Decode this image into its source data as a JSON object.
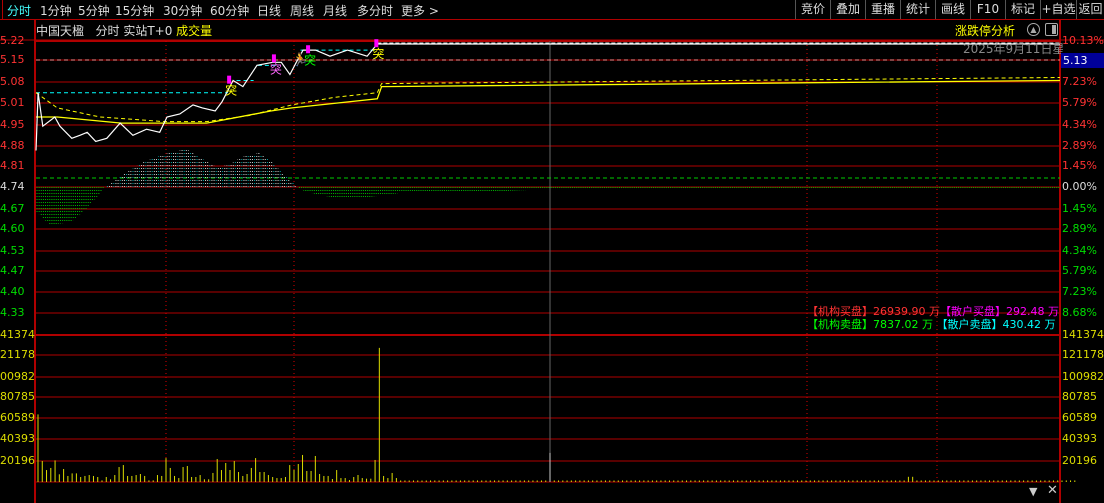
{
  "toolbar": {
    "periods": [
      "分时",
      "1分钟",
      "5分钟",
      "15分钟",
      "30分钟",
      "60分钟",
      "日线",
      "周线",
      "月线",
      "多分时",
      "更多 >"
    ],
    "active_index": 0,
    "right_buttons": [
      "竞价",
      "叠加",
      "重播",
      "统计",
      "画线",
      "F10",
      "标记",
      "+自选",
      "返回"
    ]
  },
  "header": {
    "stock_name": "中国天楹",
    "mode": "分时",
    "realtime": "实站T+0",
    "indicator": "成交量",
    "analysis": "涨跌停分析",
    "date": "2025年9月11日星"
  },
  "colors": {
    "grid": "#b00000",
    "up": "#ff3333",
    "down": "#00dd00",
    "price": "#ffffff",
    "avg": "#ffff00",
    "volume": "#d8d800",
    "highlight_bg": "#000099"
  },
  "icons": [
    "upload-icon",
    "panel-toggle-icon",
    "dropdown-arrow-icon",
    "close-icon"
  ],
  "price_axis": {
    "left": [
      "5.22",
      "5.15",
      "5.08",
      "5.01",
      "4.95",
      "4.88",
      "4.81",
      "4.74",
      "4.67",
      "4.60",
      "4.53",
      "4.47",
      "4.40",
      "4.33"
    ],
    "right": [
      "10.13%",
      "",
      "7.23%",
      "5.79%",
      "4.34%",
      "2.89%",
      "1.45%",
      "0.00%",
      "1.45%",
      "2.89%",
      "4.34%",
      "5.79%",
      "7.23%",
      "8.68%"
    ],
    "current_price": "5.13",
    "prev_close": 4.74,
    "top": 5.22,
    "bottom": 4.26
  },
  "volume_axis": {
    "labels": [
      "141374",
      "121178",
      "100982",
      "80785",
      "60589",
      "40393",
      "20196"
    ],
    "max": 141374
  },
  "legend": {
    "inst_buy_label": "【机构买盘】",
    "inst_buy_value": "26939.90 万",
    "retail_buy_label": "【散户买盘】",
    "retail_buy_value": "292.48 万",
    "inst_sell_label": "【机构卖盘】",
    "inst_sell_value": "7837.02 万",
    "retail_sell_label": "【散户卖盘】",
    "retail_sell_value": "430.42 万"
  },
  "chart_data": {
    "type": "line",
    "minutes_total": 240,
    "price": [
      [
        0,
        4.86
      ],
      [
        0.5,
        5.05
      ],
      [
        1.6,
        4.94
      ],
      [
        4.4,
        4.97
      ],
      [
        5.6,
        4.94
      ],
      [
        8.4,
        4.9
      ],
      [
        10.3,
        4.91
      ],
      [
        12,
        4.92
      ],
      [
        14,
        4.89
      ],
      [
        16.6,
        4.9
      ],
      [
        19.7,
        4.95
      ],
      [
        22.7,
        4.91
      ],
      [
        25.9,
        4.93
      ],
      [
        29,
        4.92
      ],
      [
        30.7,
        4.97
      ],
      [
        33.7,
        4.98
      ],
      [
        36.8,
        5.01
      ],
      [
        39,
        5.0
      ],
      [
        42,
        4.99
      ],
      [
        43.6,
        5.02
      ],
      [
        46.2,
        5.09
      ],
      [
        48.5,
        5.07
      ],
      [
        51.8,
        5.14
      ],
      [
        55.5,
        5.15
      ],
      [
        57.5,
        5.15
      ],
      [
        59.5,
        5.11
      ],
      [
        61,
        5.15
      ],
      [
        62.6,
        5.19
      ],
      [
        65.5,
        5.19
      ],
      [
        68.9,
        5.17
      ],
      [
        73,
        5.19
      ],
      [
        77.6,
        5.17
      ],
      [
        80,
        5.21
      ],
      [
        240,
        5.21
      ]
    ],
    "avg": [
      [
        0,
        4.97
      ],
      [
        5,
        4.97
      ],
      [
        20,
        4.95
      ],
      [
        40,
        4.95
      ],
      [
        55,
        4.99
      ],
      [
        60,
        5.0
      ],
      [
        80,
        5.03
      ],
      [
        81,
        5.07
      ],
      [
        240,
        5.09
      ]
    ],
    "avg2": [
      [
        0,
        5.05
      ],
      [
        5,
        5.0
      ],
      [
        15,
        4.97
      ],
      [
        30,
        4.955
      ],
      [
        40,
        4.955
      ],
      [
        50,
        4.975
      ],
      [
        60,
        5.01
      ],
      [
        70,
        5.035
      ],
      [
        80,
        5.05
      ],
      [
        81,
        5.08
      ],
      [
        240,
        5.1
      ]
    ],
    "resistance": [
      [
        0,
        45,
        5.05
      ],
      [
        47,
        51,
        5.09
      ],
      [
        52,
        57,
        5.14
      ],
      [
        62,
        80,
        5.19
      ]
    ],
    "markers": [
      {
        "m": 45.5,
        "p": 5.06,
        "label": "突",
        "color": "#ffff00"
      },
      {
        "m": 56,
        "p": 5.13,
        "label": "突",
        "color": "#ff66ff"
      },
      {
        "m": 64,
        "p": 5.16,
        "label": "突",
        "color": "#00ff00"
      },
      {
        "m": 80,
        "p": 5.18,
        "label": "突",
        "color": "#ffff00"
      }
    ],
    "flow": [
      [
        0,
        -25
      ],
      [
        3,
        -38
      ],
      [
        8,
        -35
      ],
      [
        12,
        -20
      ],
      [
        15,
        -5
      ],
      [
        16,
        0
      ],
      [
        17,
        3
      ],
      [
        20,
        12
      ],
      [
        25,
        25
      ],
      [
        30,
        33
      ],
      [
        35,
        38
      ],
      [
        38,
        30
      ],
      [
        42,
        20
      ],
      [
        45,
        22
      ],
      [
        48,
        30
      ],
      [
        52,
        34
      ],
      [
        55,
        25
      ],
      [
        58,
        12
      ],
      [
        61,
        0
      ],
      [
        62,
        -3
      ],
      [
        66,
        -8
      ],
      [
        72,
        -12
      ],
      [
        78,
        -10
      ],
      [
        85,
        -6
      ],
      [
        95,
        -5
      ],
      [
        110,
        -4
      ],
      [
        120,
        -2
      ],
      [
        240,
        -1
      ]
    ],
    "volume": [
      65000,
      20200,
      11500,
      13500,
      20800,
      7400,
      12500,
      5800,
      8300,
      8300,
      4800,
      5800,
      6700,
      5800,
      4800,
      1600,
      4800,
      2600,
      6700,
      14400,
      16300,
      5800,
      5800,
      6700,
      7700,
      5800,
      1600,
      1600,
      6700,
      5800,
      23000,
      13500,
      5800,
      3800,
      14400,
      15400,
      4800,
      4800,
      6700,
      2600,
      2600,
      8700,
      22100,
      11500,
      18300,
      11500,
      20200,
      9600,
      5800,
      7700,
      13500,
      23000,
      9600,
      9600,
      6700,
      4800,
      3800,
      3800,
      4800,
      16300,
      11500,
      17300,
      26000,
      10600,
      10600,
      25000,
      7700,
      5800,
      5800,
      2900,
      11500,
      3800,
      3800,
      1900,
      4800,
      6700,
      3800,
      3200,
      3200,
      21200,
      129000,
      5800,
      3800,
      8700,
      3800,
      1500,
      1500,
      1500,
      1500,
      1500,
      1500,
      1500,
      1500,
      1500,
      1500,
      1500,
      1500,
      1500,
      1500,
      1500,
      1500,
      1500,
      1500,
      1500,
      1500,
      1500,
      1500,
      1500,
      1500,
      1500,
      1500,
      1500,
      1500,
      1500,
      1500,
      1500,
      1500,
      1500,
      1500,
      1500,
      28000,
      1500,
      1500,
      1500,
      1500,
      1500,
      1500,
      1500,
      1500,
      1500,
      1500,
      1500,
      1500,
      1500,
      1500,
      1500,
      1500,
      1500,
      1500,
      1500,
      1500,
      1500,
      1500,
      1500,
      1500,
      1500,
      1500,
      1500,
      1500,
      1500,
      1500,
      1500,
      1500,
      1500,
      1500,
      1500,
      1500,
      1500,
      1500,
      1500,
      1500,
      1500,
      1500,
      1500,
      1500,
      1500,
      1500,
      1500,
      1500,
      1500,
      1500,
      1500,
      1500,
      1500,
      1500,
      1500,
      1500,
      1500,
      1500,
      1500,
      1500,
      1500,
      1500,
      1500,
      1500,
      1500,
      1500,
      1500,
      1500,
      1500,
      1500,
      1500,
      1500,
      1500,
      1500,
      1500,
      1500,
      1500,
      1500,
      1500,
      1500,
      1500,
      1500,
      1500,
      5000,
      5000,
      1500,
      1500,
      1500,
      1500,
      1500,
      1500,
      1500,
      1500,
      1500,
      1500,
      1500,
      1500,
      1500,
      1500,
      1500,
      1500,
      1500,
      1500,
      1500,
      1500,
      1500,
      1500,
      1500,
      1500,
      1500,
      1500,
      1500,
      1500,
      1500,
      1500,
      1500,
      1500,
      1500,
      1500,
      1500,
      1500,
      1500,
      1500
    ]
  }
}
